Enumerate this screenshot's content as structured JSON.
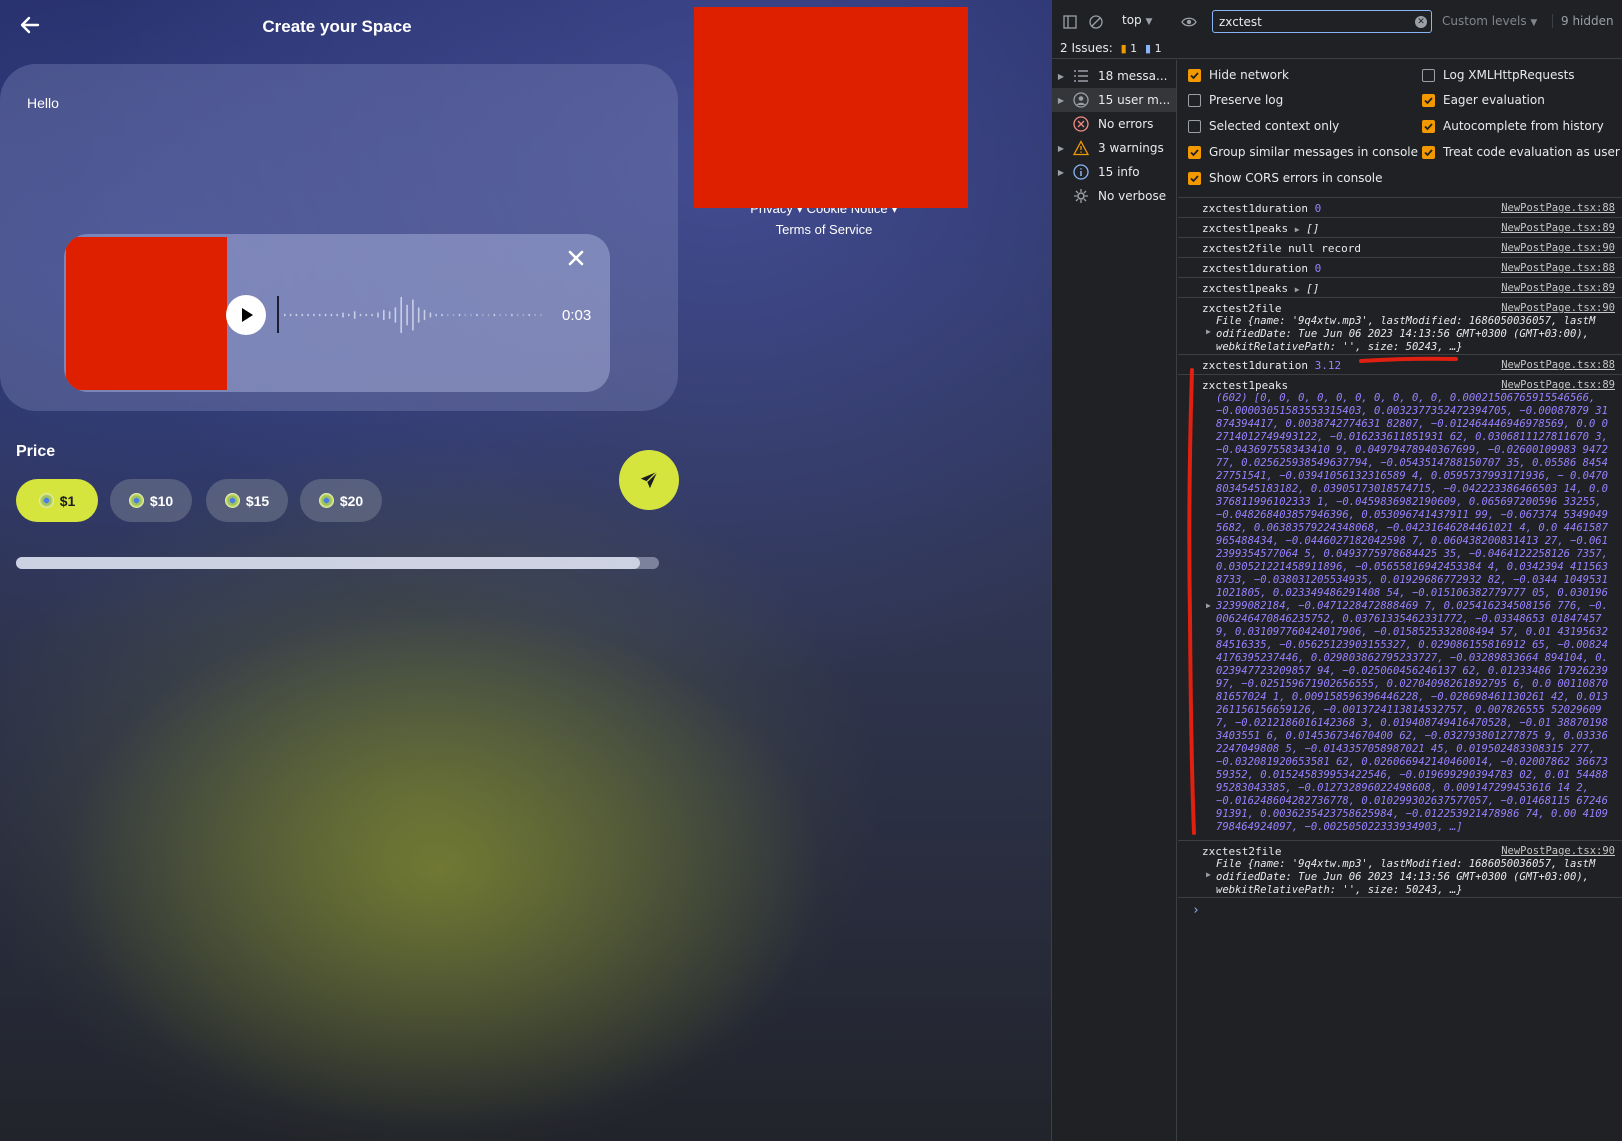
{
  "app": {
    "title": "Create your Space",
    "compose_text": "Hello",
    "audio": {
      "duration": "0:03",
      "progress": 0.0
    },
    "price": {
      "label": "Price",
      "options": [
        {
          "label": "$1",
          "selected": true
        },
        {
          "label": "$10",
          "selected": false
        },
        {
          "label": "$15",
          "selected": false
        },
        {
          "label": "$20",
          "selected": false
        }
      ]
    },
    "upload_progress": 0.97,
    "footer": {
      "link1": "Privacy",
      "link2": "Cookie Notice",
      "link3": "Terms of Service"
    },
    "colors": {
      "accent": "#d6e53d",
      "redacted": "#de2000"
    }
  },
  "devtools": {
    "context": "top",
    "filter": "zxctest",
    "levels": "Custom levels",
    "hidden": "9 hidden",
    "issues": {
      "label": "2 Issues:",
      "warn": "1",
      "info": "1"
    },
    "sidebar": [
      {
        "label": "18 messa...",
        "icon": "list-icon",
        "expandable": true,
        "selected": false
      },
      {
        "label": "15 user m...",
        "icon": "user-icon",
        "expandable": true,
        "selected": true
      },
      {
        "label": "No errors",
        "icon": "error-icon",
        "expandable": false,
        "selected": false
      },
      {
        "label": "3 warnings",
        "icon": "warning-icon",
        "expandable": true,
        "selected": false
      },
      {
        "label": "15 info",
        "icon": "info-icon",
        "expandable": true,
        "selected": false
      },
      {
        "label": "No verbose",
        "icon": "verbose-icon",
        "expandable": false,
        "selected": false
      }
    ],
    "settings_left": [
      {
        "label": "Hide network",
        "checked": true
      },
      {
        "label": "Preserve log",
        "checked": false
      },
      {
        "label": "Selected context only",
        "checked": false
      },
      {
        "label": "Group similar messages in console",
        "checked": true
      },
      {
        "label": "Show CORS errors in console",
        "checked": true
      }
    ],
    "settings_right": [
      {
        "label": "Log XMLHttpRequests",
        "checked": false
      },
      {
        "label": "Eager evaluation",
        "checked": true
      },
      {
        "label": "Autocomplete from history",
        "checked": true
      },
      {
        "label": "Treat code evaluation as user actio",
        "checked": true
      }
    ],
    "messages": {
      "m1": {
        "text": "zxctest1duration",
        "value": "0",
        "src": "NewPostPage.tsx:88"
      },
      "m2": {
        "text": "zxctest1peaks",
        "value": "[]",
        "src": "NewPostPage.tsx:89"
      },
      "m3": {
        "text": "zxctest2file null record",
        "src": "NewPostPage.tsx:90"
      },
      "m4": {
        "text": "zxctest1duration",
        "value": "0",
        "src": "NewPostPage.tsx:88"
      },
      "m5": {
        "text": "zxctest1peaks",
        "value": "[]",
        "src": "NewPostPage.tsx:89"
      },
      "m6": {
        "text": "zxctest2file",
        "src": "NewPostPage.tsx:90",
        "line1": "File {name: '9q4xtw.mp3', lastModified: 1686050036057, lastM",
        "line2": "odifiedDate: Tue Jun 06 2023 14:13:56 GMT+0300 (GMT+03:00),",
        "line3": "webkitRelativePath: '', size: 50243, …}"
      },
      "m7": {
        "text": "zxctest1duration",
        "value": "3.12",
        "src": "NewPostPage.tsx:88"
      },
      "m8": {
        "text": "zxctest1peaks",
        "src": "NewPostPage.tsx:89",
        "peaks": "(602) [0, 0, 0, 0, 0, 0, 0, 0, 0, 0, 0.00021506765915546566, −0.00003051583553315403, 0.0032377352472394705, −0.00087879 31874394417, 0.0038742774631 82807, −0.012464446946978569, 0.0 02714012749493122, −0.016233611851931 62, 0.0306811127811670 3, −0.043697558343410 9, 0.04979478940367699, −0.02600109983 947277, 0.025625938549637794, −0.0543514788150707 35, 0.05586 845427751541, −0.03941056132316589 4, 0.0595737993171936, − 0.04708034545183182, 0.03905173018574715, −0.042223386466503 14, 0.0376811996102333 1, −0.0459836982190609, 0.065697200596 33255, −0.048268403857946396, 0.053096741437911 99, −0.067374 53490495682, 0.06383579224348068, −0.04231646284461021 4, 0.0 4461587965488434, −0.0446027182042598 7, 0.060438200831413 27, −0.0612399354577064 5, 0.0493775978684425 35, −0.0464122258126 7357, 0.030521221458911896, −0.05655816942453384 4, 0.0342394 4115638733, −0.038031205534935, 0.01929686772932 82, −0.0344 10495311021805, 0.023349486291408 54, −0.015106382779777 05, 0.03019632399082184, −0.0471228472888469 7, 0.025416234508156 776, −0.006246470846235752, 0.03761335462331772, −0.03348653 018474579, 0.031097760424017906, −0.0158525332808494 57, 0.01 4319563284516335, −0.05625123903155327, 0.029086155816912 65, −0.008244176395237446, 0.029803862795233727, −0.03289833664 894104, 0.023947723209857 94, −0.025060456246137 62, 0.01233486 1792623997, −0.025159671902656555, 0.02704098261892795 6, 0.0 0011087081657024 1, 0.009158596396446228, −0.028698461130261 42, 0.013261156156659126, −0.0013724113814532757, 0.007826555 520296097, −0.0212186016142368 3, 0.019408749416470528, −0.01 388701983403551 6, 0.014536734670400 62, −0.032793801277875 9, 0.033362247049808 5, −0.0143357058987021 45, 0.019502483308315 277, −0.032081920653581 62, 0.026066942140460014, −0.02007862 3667359352, 0.015245839953422546, −0.019699290394783 02, 0.01 5448895283043385, −0.012732896022498608, 0.009147299453616 14 2, −0.016248604282736778, 0.010299302637577057, −0.01468115 6724691391, 0.0036235423758625984, −0.012253921478986 74, 0.00 4109798464924097, −0.002505022333934903, …]"
      },
      "m9": {
        "text": "zxctest2file",
        "src": "NewPostPage.tsx:90",
        "line1": "File {name: '9q4xtw.mp3', lastModified: 1686050036057, lastM",
        "line2": "odifiedDate: Tue Jun 06 2023 14:13:56 GMT+0300 (GMT+03:00),",
        "line3": "webkitRelativePath: '', size: 50243, …}"
      }
    }
  }
}
